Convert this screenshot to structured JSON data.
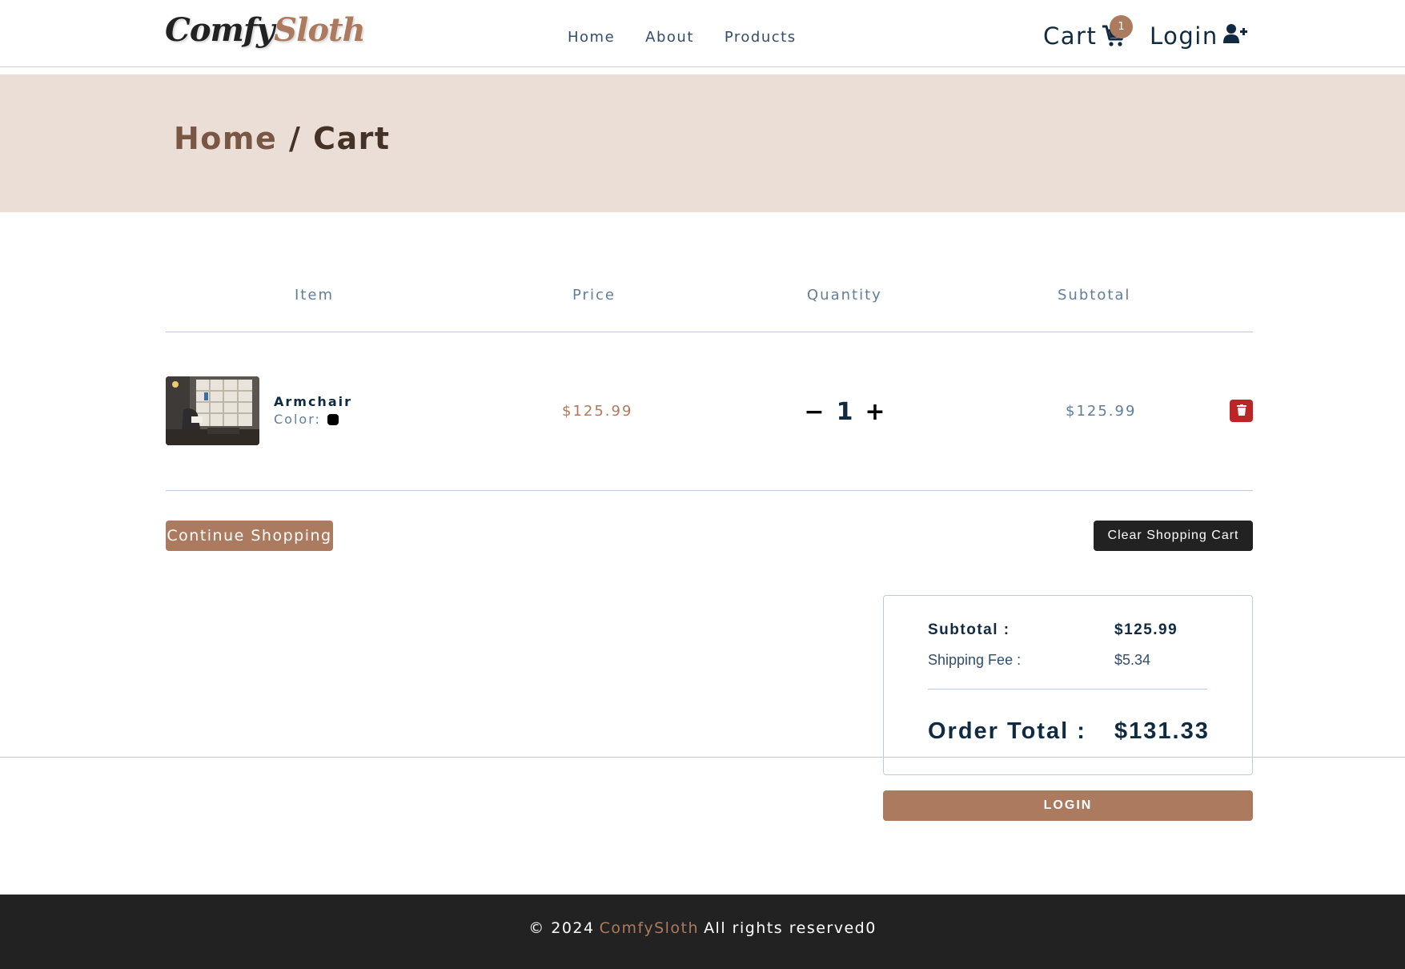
{
  "nav": {
    "logo_part1": "Comfy",
    "logo_part2": "Sloth",
    "links": [
      "Home",
      "About",
      "Products"
    ],
    "cart_label": "Cart",
    "cart_count": "1",
    "login_label": "Login"
  },
  "hero": {
    "breadcrumb_home": "Home",
    "breadcrumb_separator": " / ",
    "breadcrumb_current": "Cart"
  },
  "table": {
    "headers": [
      "Item",
      "Price",
      "Quantity",
      "Subtotal"
    ]
  },
  "cart_items": [
    {
      "name": "Armchair",
      "color_label": "Color:",
      "color": "#000000",
      "price": "$125.99",
      "quantity": "1",
      "subtotal": "$125.99"
    }
  ],
  "qty_controls": {
    "decrease": "−",
    "increase": "+"
  },
  "buttons": {
    "continue": "Continue Shopping",
    "clear": "Clear Shopping Cart",
    "login": "LOGIN"
  },
  "totals": {
    "subtotal_label": "Subtotal :",
    "subtotal_value": "$125.99",
    "shipping_label": "Shipping Fee :",
    "shipping_value": "$5.34",
    "order_total_label": "Order Total :",
    "order_total_value": "$131.33"
  },
  "footer": {
    "copyright": "© 2024",
    "brand": "ComfySloth",
    "rights": "All rights reserved0"
  },
  "colors": {
    "accent": "#ab7a5f",
    "hero_bg": "#eaded7",
    "danger": "#bb2525",
    "dark": "#222222",
    "text_primary": "#102a42"
  }
}
